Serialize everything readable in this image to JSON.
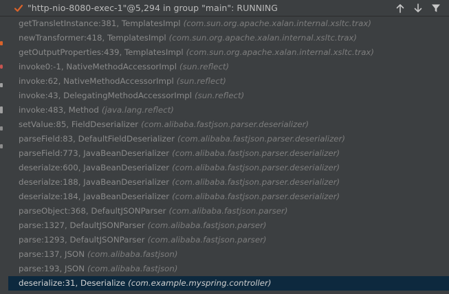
{
  "header": {
    "thread_title": "\"http-nio-8080-exec-1\"@5,294 in group \"main\": RUNNING"
  },
  "colors": {
    "check": "#d9632b",
    "selected_row": "#0d293e"
  },
  "frames": [
    {
      "method": "getTransletInstance:381, TemplatesImpl",
      "pkg": "(com.sun.org.apache.xalan.internal.xsltc.trax)"
    },
    {
      "method": "newTransformer:418, TemplatesImpl",
      "pkg": "(com.sun.org.apache.xalan.internal.xsltc.trax)"
    },
    {
      "method": "getOutputProperties:439, TemplatesImpl",
      "pkg": "(com.sun.org.apache.xalan.internal.xsltc.trax)"
    },
    {
      "method": "invoke0:-1, NativeMethodAccessorImpl",
      "pkg": "(sun.reflect)"
    },
    {
      "method": "invoke:62, NativeMethodAccessorImpl",
      "pkg": "(sun.reflect)"
    },
    {
      "method": "invoke:43, DelegatingMethodAccessorImpl",
      "pkg": "(sun.reflect)"
    },
    {
      "method": "invoke:483, Method",
      "pkg": "(java.lang.reflect)"
    },
    {
      "method": "setValue:85, FieldDeserializer",
      "pkg": "(com.alibaba.fastjson.parser.deserializer)"
    },
    {
      "method": "parseField:83, DefaultFieldDeserializer",
      "pkg": "(com.alibaba.fastjson.parser.deserializer)"
    },
    {
      "method": "parseField:773, JavaBeanDeserializer",
      "pkg": "(com.alibaba.fastjson.parser.deserializer)"
    },
    {
      "method": "deserialze:600, JavaBeanDeserializer",
      "pkg": "(com.alibaba.fastjson.parser.deserializer)"
    },
    {
      "method": "deserialze:188, JavaBeanDeserializer",
      "pkg": "(com.alibaba.fastjson.parser.deserializer)"
    },
    {
      "method": "deserialze:184, JavaBeanDeserializer",
      "pkg": "(com.alibaba.fastjson.parser.deserializer)"
    },
    {
      "method": "parseObject:368, DefaultJSONParser",
      "pkg": "(com.alibaba.fastjson.parser)"
    },
    {
      "method": "parse:1327, DefaultJSONParser",
      "pkg": "(com.alibaba.fastjson.parser)"
    },
    {
      "method": "parse:1293, DefaultJSONParser",
      "pkg": "(com.alibaba.fastjson.parser)"
    },
    {
      "method": "parse:137, JSON",
      "pkg": "(com.alibaba.fastjson)"
    },
    {
      "method": "parse:193, JSON",
      "pkg": "(com.alibaba.fastjson)"
    },
    {
      "method": "deserialize:31, Deserialize",
      "pkg": "(com.example.myspring.controller)"
    }
  ],
  "selected_index": 18
}
